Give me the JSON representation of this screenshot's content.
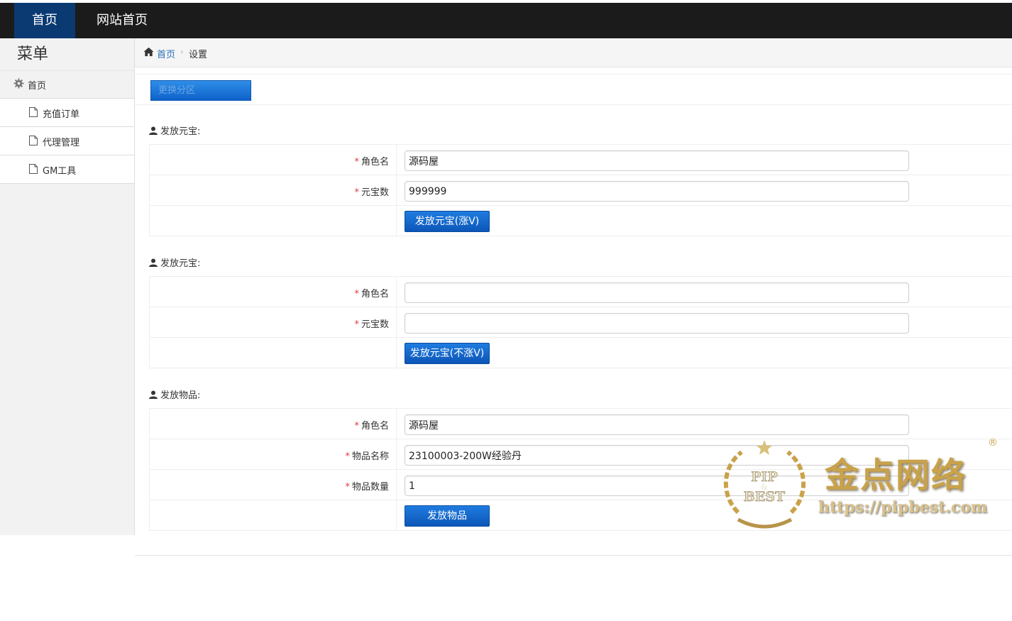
{
  "topnav": {
    "active_label": "首页",
    "site_label": "网站首页"
  },
  "sidebar": {
    "title": "菜单",
    "home_label": "首页",
    "items": [
      {
        "label": "充值订单",
        "icon": "file-icon"
      },
      {
        "label": "代理管理",
        "icon": "file-icon"
      },
      {
        "label": "GM工具",
        "icon": "file-icon"
      }
    ]
  },
  "breadcrumb": {
    "home": "首页",
    "separator": "›",
    "current": "设置"
  },
  "toolbar": {
    "switch_label": "更换分区"
  },
  "sections": [
    {
      "title": "发放元宝:",
      "fields": [
        {
          "label": "角色名",
          "value": ""
        },
        {
          "label": "元宝数",
          "value": ""
        }
      ],
      "submit": "发放元宝(涨V)"
    },
    {
      "title": "发放元宝:",
      "fields": [
        {
          "label": "角色名",
          "value": ""
        },
        {
          "label": "元宝数",
          "value": ""
        }
      ],
      "submit": "发放元宝(不涨V)"
    },
    {
      "title": "发放物品:",
      "fields": [
        {
          "label": "角色名",
          "value": ""
        },
        {
          "label": "物品名称",
          "value": ""
        },
        {
          "label": "物品数量",
          "value": ""
        }
      ],
      "submit": "发放物品"
    }
  ],
  "form_values": {
    "s1_role": "源码屋",
    "s1_amount": "999999",
    "s2_role": "",
    "s2_amount": "",
    "s3_role": "源码屋",
    "s3_item": "23100003-200W经验丹",
    "s3_qty": "1"
  },
  "required_mark": "*",
  "watermark": {
    "seal_top": "PIP",
    "seal_mid": "&",
    "seal_bottom": "BEST",
    "brand": "金点网络",
    "url": "https://pipbest.com",
    "reg": "®"
  },
  "colors": {
    "topbar": "#1b1b1b",
    "nav_active": "#0b3a73",
    "link": "#2a6ebb",
    "button": "#0d56b8",
    "required": "#e4393c",
    "watermark_gold": "#c9a24a"
  }
}
